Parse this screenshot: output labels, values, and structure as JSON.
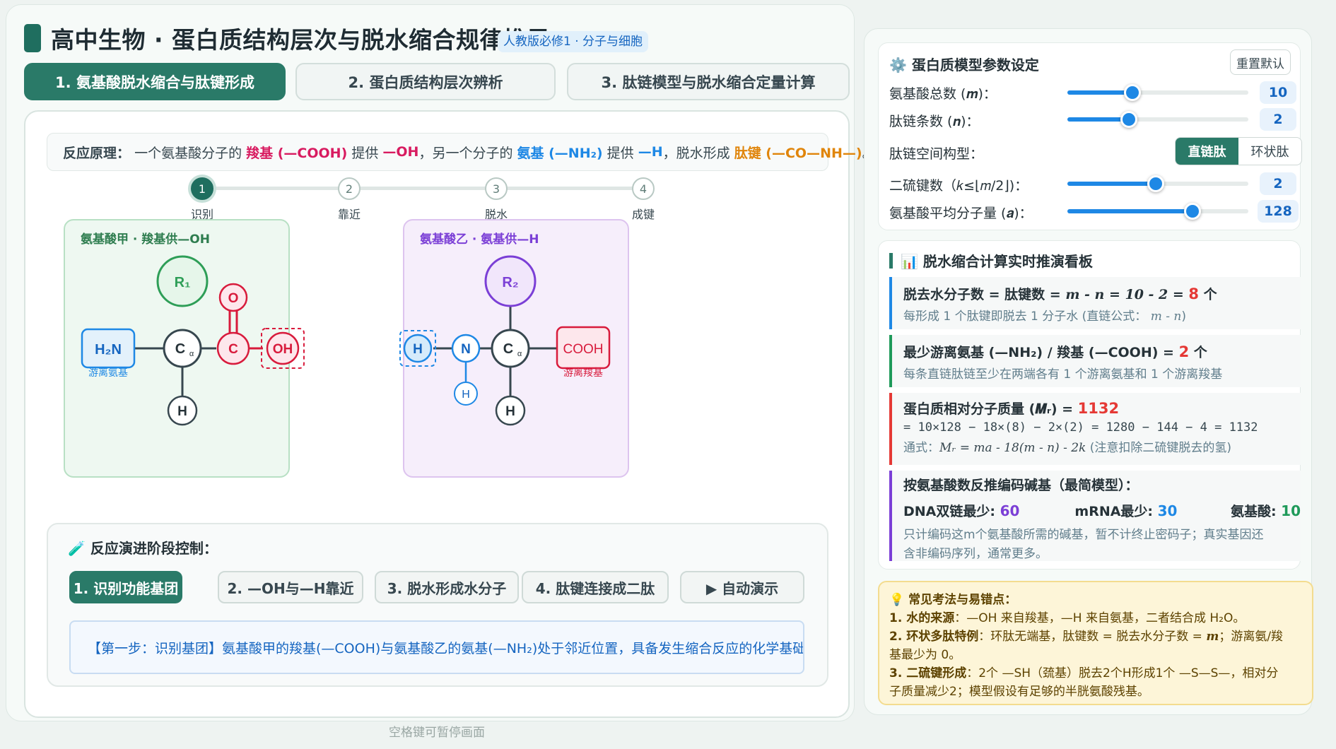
{
  "header": {
    "title": "高中生物 · 蛋白质结构层次与脱水缩合规律推导",
    "tag": "人教版必修1 · 分子与细胞"
  },
  "tabs": [
    {
      "label": "1. 氨基酸脱水缩合与肽键形成",
      "active": true
    },
    {
      "label": "2. 蛋白质结构层次辨析",
      "active": false
    },
    {
      "label": "3. 肽链模型与脱水缩合定量计算",
      "active": false
    }
  ],
  "principle": {
    "prefix": "反应原理：",
    "t1": "一个氨基酸分子的",
    "carboxyl": "羧基 (—COOH)",
    "t2": "提供",
    "oh": "—OH",
    "t3": "，另一个分子的",
    "amino": "氨基 (—NH₂)",
    "t4": "提供",
    "h": "—H",
    "t5": "，脱水形成",
    "peptide": "肽键 (—CO—NH—)",
    "t6": "。"
  },
  "steps": [
    {
      "num": "1",
      "label": "识别",
      "active": true
    },
    {
      "num": "2",
      "label": "靠近",
      "active": false
    },
    {
      "num": "3",
      "label": "脱水",
      "active": false
    },
    {
      "num": "4",
      "label": "成键",
      "active": false
    }
  ],
  "molecule_a": {
    "label": "氨基酸甲 · 羧基供—OH",
    "r": "R₁",
    "nh2": "H₂N",
    "ca": "C",
    "ca_sub": "α",
    "c": "C",
    "o": "O",
    "oh": "OH",
    "h": "H",
    "free_note": "游离氨基"
  },
  "molecule_b": {
    "label": "氨基酸乙 · 氨基供—H",
    "r": "R₂",
    "h_left": "H",
    "n": "N",
    "h_n": "H",
    "ca": "C",
    "ca_sub": "α",
    "cooh": "COOH",
    "h": "H",
    "free_note": "游离羧基"
  },
  "control": {
    "title": "🧪 反应演进阶段控制：",
    "buttons": [
      {
        "label": "1. 识别功能基团",
        "active": true
      },
      {
        "label": "2. —OH与—H靠近",
        "active": false
      },
      {
        "label": "3. 脱水形成水分子",
        "active": false
      },
      {
        "label": "4. 肽键连接成二肽",
        "active": false
      },
      {
        "label": "▶ 自动演示",
        "active": false
      }
    ],
    "description": "【第一步：识别基团】氨基酸甲的羧基(—COOH)与氨基酸乙的氨基(—NH₂)处于邻近位置，具备发生缩合反应的化学基础。"
  },
  "footer_hint": "空格键可暂停画面",
  "params": {
    "title": "⚙️ 蛋白质模型参数设定",
    "reset_label": "重置默认",
    "amino_total": {
      "label": "氨基酸总数 (𝒎)：",
      "value": 10,
      "fraction": 0.36
    },
    "chains": {
      "label": "肽链条数 (𝒏)：",
      "value": 2,
      "fraction": 0.34
    },
    "topology": {
      "label": "肽链空间构型：",
      "options": [
        "直链肽",
        "环状肽"
      ],
      "selected": "直链肽"
    },
    "disulfide": {
      "label": "二硫键数（𝑘≤⌊𝑚/2⌋)：",
      "value": 2,
      "fraction": 0.49
    },
    "avg_mass": {
      "label": "氨基酸平均分子量 (𝒂)：",
      "value": 128,
      "fraction": 0.69
    }
  },
  "calc": {
    "title": "📊 脱水缩合计算实时推演看板",
    "water": {
      "main_prefix": "脱去水分子数 = 肽键数 = ",
      "formula": "m - n = 10 - 2 = ",
      "value": "8",
      "unit": " 个",
      "sub": "每形成 1 个肽键即脱去 1 分子水 (直链公式：",
      "sub_formula": "m - n",
      "sub_end": ")",
      "color": "#1e88e5"
    },
    "free_groups": {
      "main_prefix": "最少游离氨基 (—NH₂) / 羧基 (—COOH) = ",
      "value": "2",
      "unit": " 个",
      "sub": "每条直链肽链至少在两端各有 1 个游离氨基和 1 个游离羧基",
      "color": "#1f9a5a"
    },
    "mass": {
      "main_prefix": "蛋白质相对分子质量 (𝑴ᵣ) = ",
      "value": "1132",
      "line2": "= 10×128 − 18×(8) − 2×(2) = 1280 − 144 − 4 = 1132",
      "general_prefix": "通式：",
      "general_formula": "Mᵣ = ma - 18(m - n) - 2k",
      "general_note": " (注意扣除二硫键脱去的氢)",
      "color": "#e53935"
    },
    "bases": {
      "main": "按氨基酸数反推编码碱基（最简模型）：",
      "dna_label": "DNA双链最少: ",
      "dna_value": "60",
      "mrna_label": "mRNA最少: ",
      "mrna_value": "30",
      "aa_label": "氨基酸: ",
      "aa_value": "10",
      "sub1": "只计编码这m个氨基酸所需的碱基，暂不计终止密码子；真实基因还",
      "sub2": "含非编码序列，通常更多。",
      "color": "#7b3fd6"
    }
  },
  "tips": {
    "title": "💡 常见考法与易错点：",
    "l1_key": "1. 水的来源",
    "l1": "：—OH 来自羧基，—H 来自氨基，二者结合成 H₂O。",
    "l2_key": "2. 环状多肽特例",
    "l2a": "：环肽无端基，肽键数 = 脱去水分子数 = ",
    "l2_m": "m",
    "l2b": "；游离氨/羧",
    "l2c": "基最少为 0。",
    "l3_key": "3. 二硫键形成",
    "l3a": "：2个 —SH（巯基）脱去2个H形成1个 —S—S—，相对分",
    "l3b": "子质量减少2；模型假设有足够的半胱氨酸残基。"
  },
  "colors": {
    "accent": "#2a7a68",
    "carboxyl": "#d81b3c",
    "amino": "#1e88e5",
    "r1": "#2e9e57",
    "r2": "#7b3fd6",
    "slider": "#1e88e5"
  }
}
